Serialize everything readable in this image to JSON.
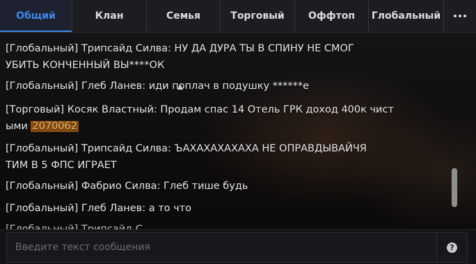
{
  "tabs": [
    {
      "label": "Общий",
      "active": true
    },
    {
      "label": "Клан"
    },
    {
      "label": "Семья"
    },
    {
      "label": "Торговый"
    },
    {
      "label": "Оффтоп"
    },
    {
      "label": "Глобальный"
    }
  ],
  "more_icon": "more-horizontal-icon",
  "messages": [
    {
      "line1": "[Глобальный] Трипсайд Силва: НУ ДА ДУРА ТЫ В СПИНУ НЕ СМОГ",
      "line2": "УБИТЬ КОНЧЕННЫЙ ВЫ****ОК"
    },
    {
      "line1": "[Глобальный] Глеб Ланев: иди поплач в подушку ******е"
    },
    {
      "line1": "[Торговый] Косяк Властный: Продам спас 14 Отель ГРК доход 400к чист",
      "line2": "ыми",
      "code": "2070062"
    },
    {
      "line1": "[Глобальный] Трипсайд Силва: ЪАХАХАХАХАХА НЕ ОПРАВДЫВАЙЧЯ",
      "line2": "ТИМ В 5 ФПС ИГРАЕТ"
    },
    {
      "line1": "[Глобальный] Фабрио Силва: Глеб тише будь"
    },
    {
      "line1": "[Глобальный] Глеб Ланев: а то что"
    },
    {
      "line1": "[Глобальный] Трипсайд С..."
    }
  ],
  "input": {
    "placeholder": "Введите текст сообщения",
    "value": ""
  },
  "help_label": "?",
  "colors": {
    "accent": "#3f86e8",
    "code_highlight": "#8a4c12"
  }
}
